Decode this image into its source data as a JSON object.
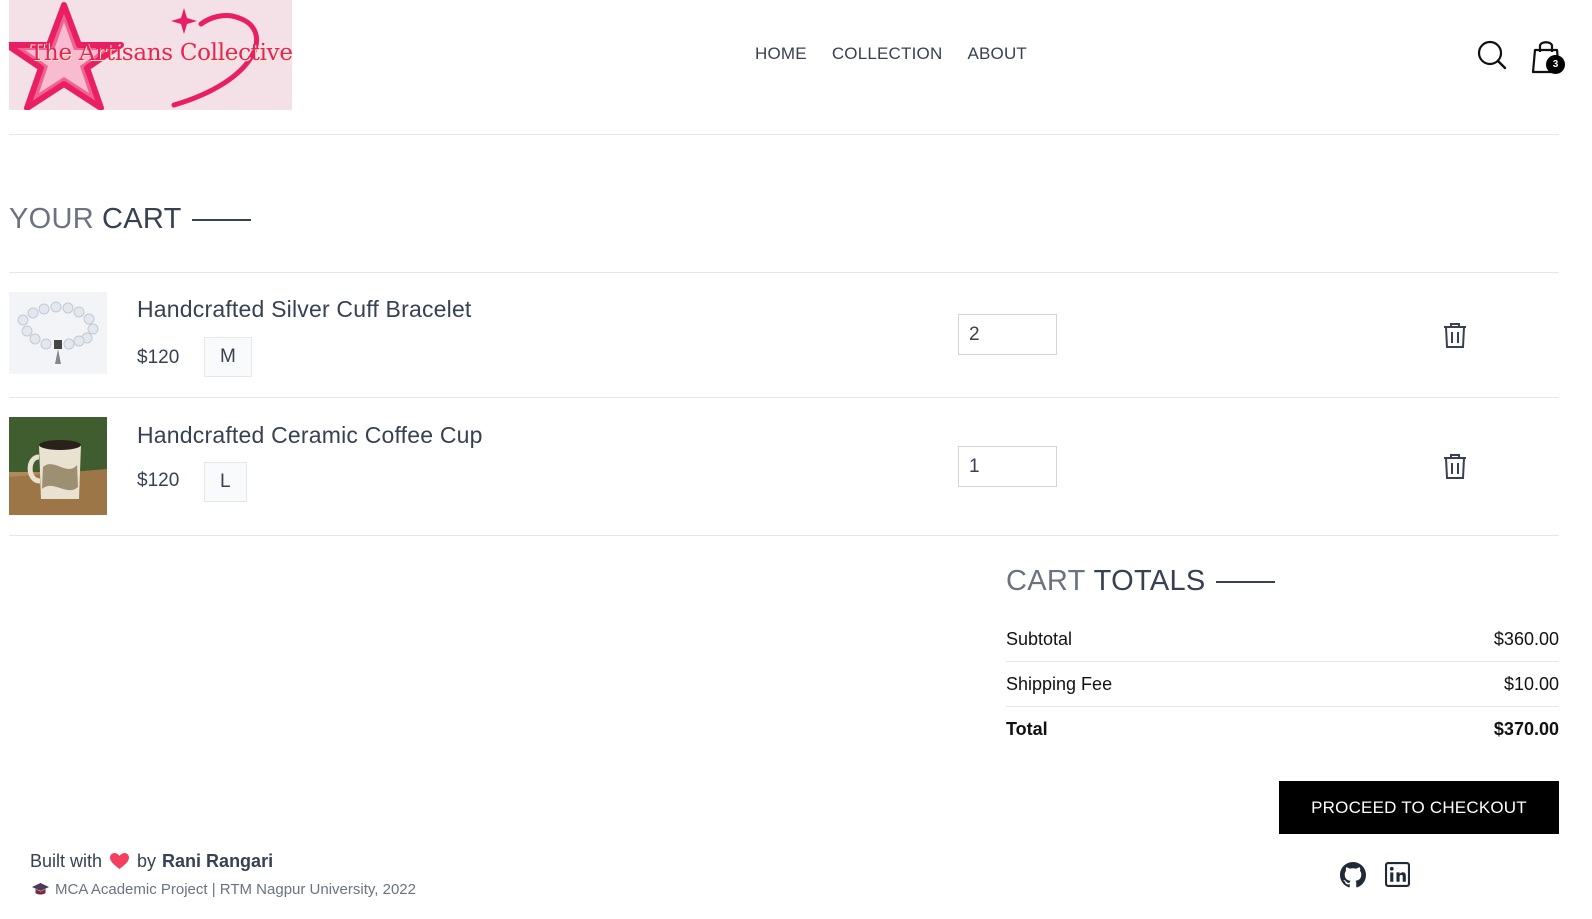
{
  "header": {
    "logo_text": "The Artisans Collective",
    "nav": [
      "HOME",
      "COLLECTION",
      "ABOUT"
    ],
    "cart_count": "3",
    "icons": [
      "search-icon",
      "shopping-bag-icon"
    ]
  },
  "cart": {
    "title_light": "YOUR",
    "title_bold": "CART",
    "items": [
      {
        "name": "Handcrafted Silver Cuff Bracelet",
        "price": "$120",
        "size": "M",
        "quantity": "2",
        "image": "bracelet-image"
      },
      {
        "name": "Handcrafted Ceramic Coffee Cup",
        "price": "$120",
        "size": "L",
        "quantity": "1",
        "image": "coffee-cup-image"
      }
    ]
  },
  "totals": {
    "title_light": "CART",
    "title_bold": "TOTALS",
    "subtotal_label": "Subtotal",
    "subtotal_value": "$360.00",
    "shipping_label": "Shipping Fee",
    "shipping_value": "$10.00",
    "total_label": "Total",
    "total_value": "$370.00",
    "checkout_label": "PROCEED TO CHECKOUT"
  },
  "footer": {
    "built_with": "Built with",
    "by": "by",
    "author": "Rani Rangari",
    "project": "MCA Academic Project | RTM Nagpur University, 2022",
    "icons": [
      "github-icon",
      "linkedin-icon"
    ]
  },
  "colors": {
    "accent": "#e91e63",
    "logo_bg": "#f3e1e7",
    "button_bg": "#000000",
    "heart": "#f43f5e"
  }
}
